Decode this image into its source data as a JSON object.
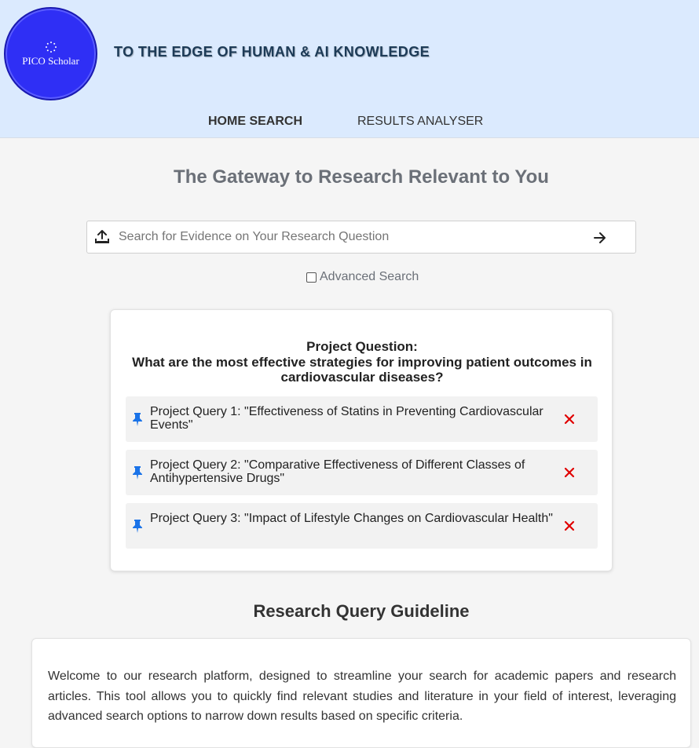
{
  "header": {
    "logo_text": "PICO Scholar",
    "tagline": "TO THE EDGE OF HUMAN & AI KNOWLEDGE",
    "nav": [
      {
        "label": "HOME SEARCH"
      },
      {
        "label": "RESULTS ANALYSER"
      }
    ]
  },
  "main": {
    "title": "The Gateway to Research Relevant to You",
    "search": {
      "placeholder": "Search for Evidence on Your Research Question",
      "value": ""
    },
    "advanced_search_label": "Advanced Search",
    "advanced_search_checked": false
  },
  "project": {
    "heading": "Project Question:",
    "question": "What are the most effective strategies for improving patient outcomes in cardiovascular diseases?",
    "queries": [
      {
        "text": "Project Query 1: \"Effectiveness of Statins in Preventing Cardiovascular Events\""
      },
      {
        "text": "Project Query 2: \"Comparative Effectiveness of Different Classes of Antihypertensive Drugs\""
      },
      {
        "text": "Project Query 3: \"Impact of Lifestyle Changes on Cardiovascular Health\""
      }
    ]
  },
  "guideline": {
    "title": "Research Query Guideline",
    "intro": "Welcome to our research platform, designed to streamline your search for academic papers and research articles. This tool allows you to quickly find relevant studies and literature in your field of interest, leveraging advanced search options to narrow down results based on specific criteria."
  },
  "colors": {
    "header_bg": "#dbeafe",
    "logo_bg": "#2f2ff5",
    "pin": "#1a73e8",
    "delete": "#e00000",
    "title_gray": "#6b7078"
  },
  "icons": {
    "logo": "gear-dots-icon",
    "upload": "upload-icon",
    "submit": "arrow-right-icon",
    "pin": "pushpin-icon",
    "delete": "close-icon"
  }
}
